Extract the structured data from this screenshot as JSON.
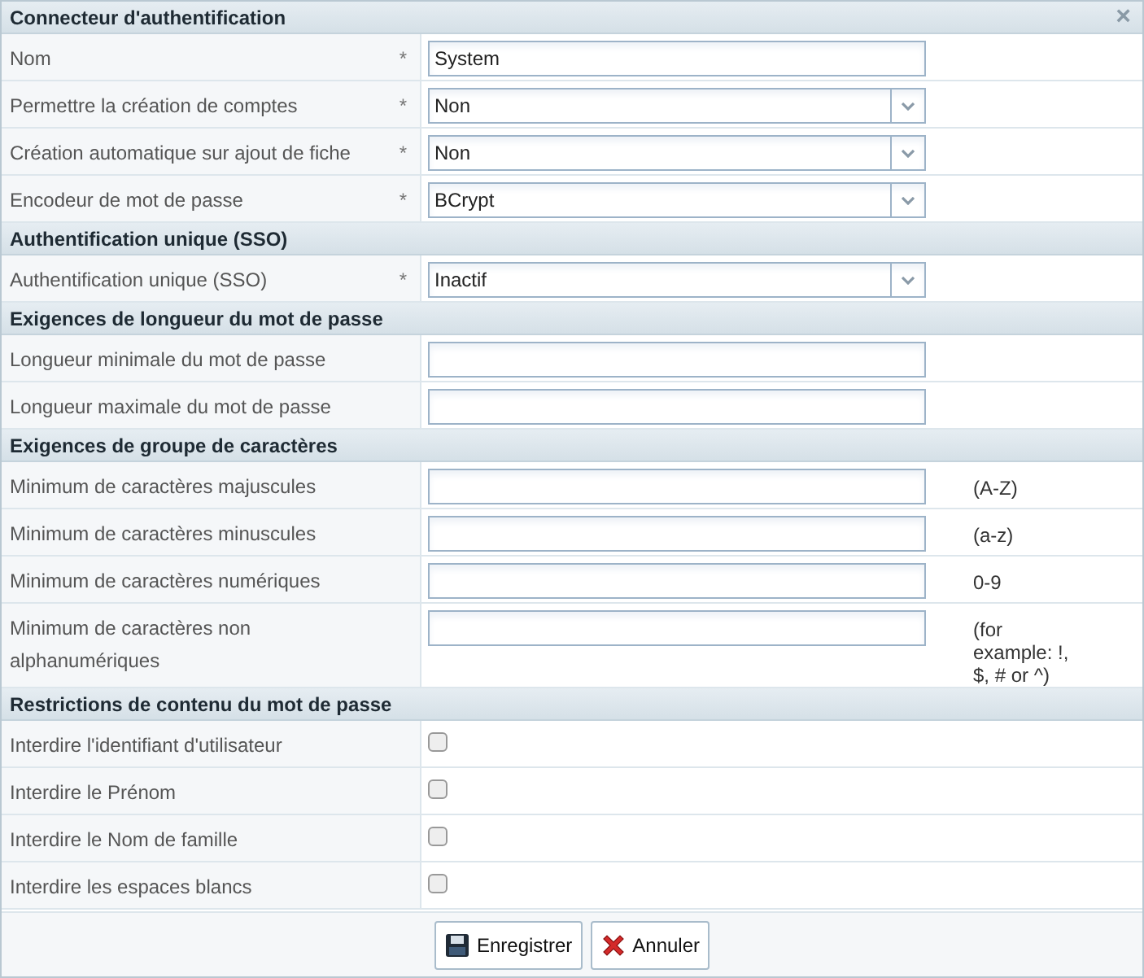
{
  "dialog": {
    "title": "Connecteur d'authentification",
    "close": "×"
  },
  "sections": [
    {
      "rows": [
        {
          "kind": "text",
          "label": "Nom",
          "marker": "*",
          "value": "System"
        },
        {
          "kind": "select",
          "label": "Permettre la création de comptes",
          "marker": "*",
          "value": "Non"
        },
        {
          "kind": "select",
          "label": "Création automatique sur ajout de fiche",
          "marker": "*",
          "value": "Non"
        },
        {
          "kind": "select",
          "label": "Encodeur de mot de passe",
          "marker": "*",
          "value": "BCrypt"
        }
      ]
    },
    {
      "title": "Authentification unique (SSO)",
      "rows": [
        {
          "kind": "select",
          "label": "Authentification unique (SSO)",
          "marker": "*",
          "value": "Inactif"
        }
      ]
    },
    {
      "title": "Exigences de longueur du mot de passe",
      "rows": [
        {
          "kind": "text",
          "label": "Longueur minimale du mot de passe"
        },
        {
          "kind": "text",
          "label": "Longueur maximale du mot de passe"
        }
      ]
    },
    {
      "title": "Exigences de groupe de caractères",
      "rows": [
        {
          "kind": "text",
          "label": "Minimum de caractères majuscules",
          "note": "(A-Z)"
        },
        {
          "kind": "text",
          "label": "Minimum de caractères minuscules",
          "note": "(a-z)"
        },
        {
          "kind": "text",
          "label": "Minimum de caractères numériques",
          "note": "0-9"
        },
        {
          "kind": "text",
          "label": "Minimum de caractères non alphanumériques",
          "note": "(for example: !, $, # or ^)"
        }
      ]
    },
    {
      "title": "Restrictions de contenu du mot de passe",
      "rows": [
        {
          "kind": "checkbox",
          "label": "Interdire l'identifiant d'utilisateur",
          "checked": false
        },
        {
          "kind": "checkbox",
          "label": "Interdire le Prénom",
          "checked": false
        },
        {
          "kind": "checkbox",
          "label": "Interdire le Nom de famille",
          "checked": false
        },
        {
          "kind": "checkbox",
          "label": "Interdire les espaces blancs",
          "checked": false
        }
      ]
    }
  ],
  "buttons": [
    {
      "kind": "save",
      "label": "Enregistrer"
    },
    {
      "kind": "cancel",
      "label": "Annuler"
    }
  ]
}
